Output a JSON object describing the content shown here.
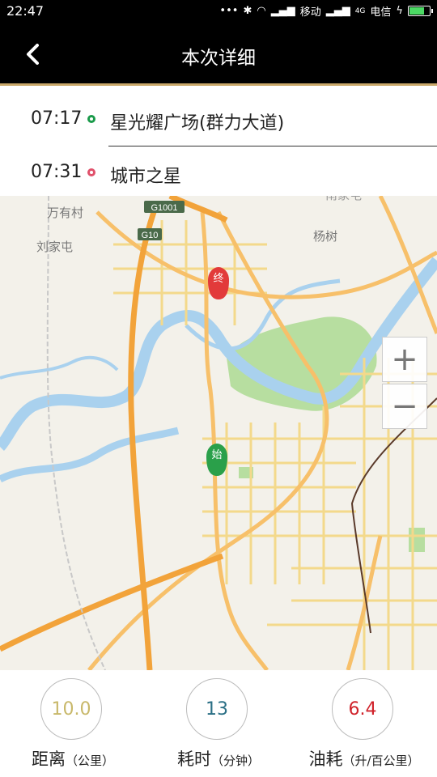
{
  "status_bar": {
    "time": "22:47",
    "carrier1": "移动",
    "carrier2": "电信",
    "network": "4G"
  },
  "header": {
    "title": "本次详细"
  },
  "route": {
    "start": {
      "time": "07:17",
      "name": "星光耀广场(群力大道)"
    },
    "end": {
      "time": "07:31",
      "name": "城市之星"
    }
  },
  "map": {
    "labels": {
      "village1": "万有村",
      "village2": "刘家屯",
      "place": "杨树",
      "top_partial": "南家屯",
      "highway1": "G1001",
      "highway2": "G10"
    },
    "markers": {
      "start": "始",
      "end": "终"
    },
    "zoom_in": "+",
    "zoom_out": "−"
  },
  "stats": {
    "distance": {
      "value": "10.0",
      "label": "距离",
      "unit": "（公里）",
      "color": "#c8b86a"
    },
    "duration": {
      "value": "13",
      "label": "耗时",
      "unit": "（分钟）",
      "color": "#2a6f85"
    },
    "fuel": {
      "value": "6.4",
      "label": "油耗",
      "unit": "（升/百公里）",
      "color": "#d0222a"
    }
  }
}
